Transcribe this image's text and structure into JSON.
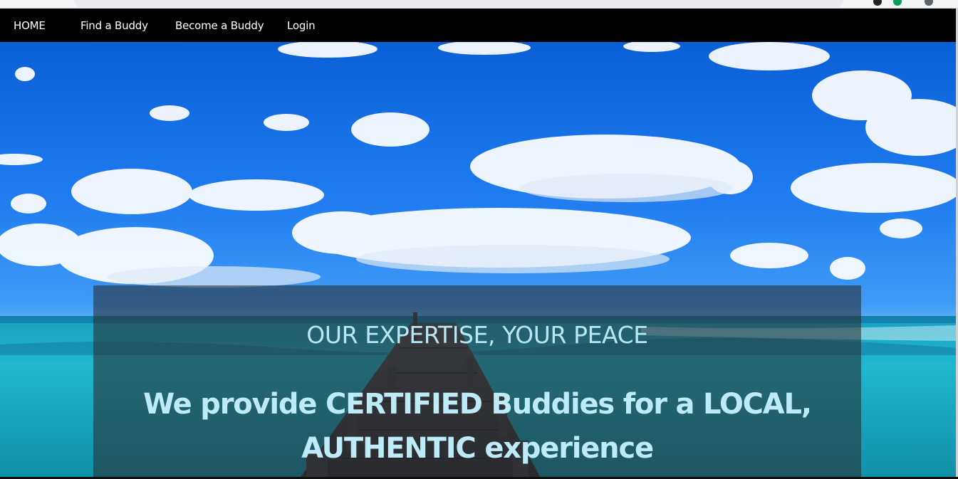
{
  "nav": {
    "items": [
      {
        "label": "HOME"
      },
      {
        "label": "Find a Buddy"
      },
      {
        "label": "Become a Buddy"
      },
      {
        "label": "Login"
      }
    ]
  },
  "hero": {
    "tagline": "OUR EXPERTISE, YOUR PEACE",
    "headline": "We provide CERTIFIED Buddies for a LOCAL, AUTHENTIC experience"
  },
  "colors": {
    "navbar_bg": "#000000",
    "nav_text": "#ffffff",
    "panel_text": "#bdebf7",
    "sky": "#1f7bf0",
    "sea": "#1fb5c9"
  }
}
